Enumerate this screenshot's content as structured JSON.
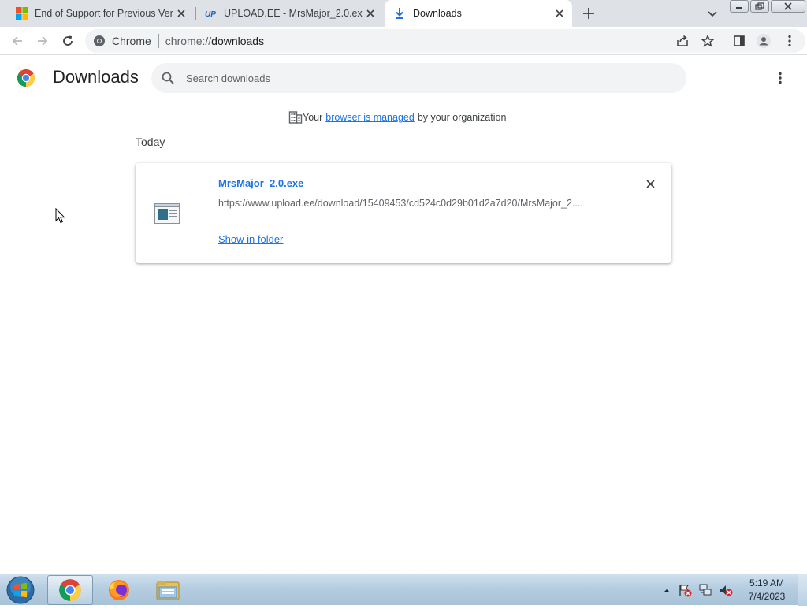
{
  "browser": {
    "tabs": [
      {
        "title": "End of Support for Previous Vers",
        "icon": "microsoft-logo-icon",
        "active": false
      },
      {
        "title": "UPLOAD.EE - MrsMajor_2.0.exe -",
        "icon": "upload-ee-icon",
        "active": false
      },
      {
        "title": "Downloads",
        "icon": "download-icon",
        "active": true
      }
    ],
    "omnibox": {
      "site_chip": "Chrome",
      "url_scheme": "chrome://",
      "url_rest": "downloads"
    }
  },
  "page": {
    "title": "Downloads",
    "search_placeholder": "Search downloads",
    "managed": {
      "prefix": "Your",
      "link": "browser is managed",
      "suffix": "by your organization"
    },
    "section_date": "Today",
    "downloads": [
      {
        "file_name": "MrsMajor_2.0.exe",
        "url": "https://www.upload.ee/download/15409453/cd524c0d29b01d2a7d20/MrsMajor_2....",
        "action": "Show in folder"
      }
    ]
  },
  "taskbar": {
    "apps": [
      "chrome-icon",
      "firefox-icon",
      "file-explorer-icon"
    ],
    "time": "5:19 AM",
    "date": "7/4/2023"
  },
  "colors": {
    "link": "#1a73e8",
    "tabstrip": "#dee1e6",
    "searchbox": "#f1f3f4"
  }
}
